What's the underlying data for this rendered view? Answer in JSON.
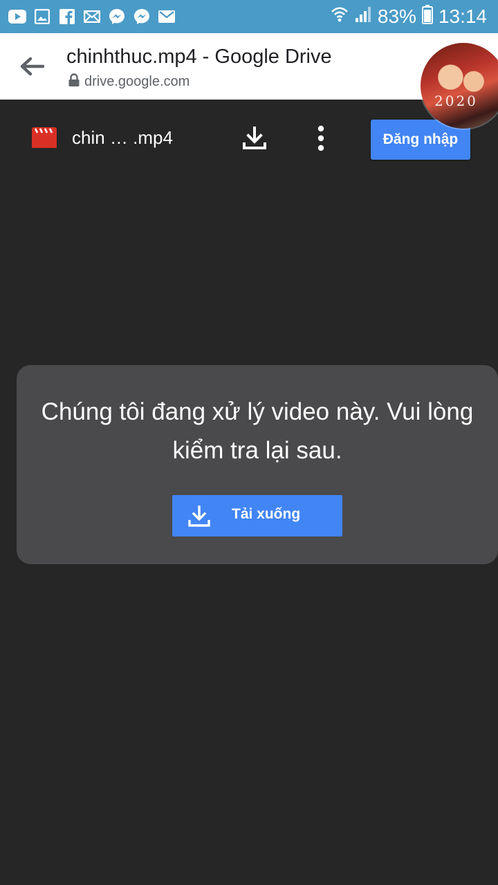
{
  "status_bar": {
    "notification_icons": [
      "youtube-icon",
      "gallery-icon",
      "facebook-icon",
      "email-icon",
      "messenger-icon",
      "messenger-icon",
      "mail-icon"
    ],
    "battery_percent": "83%",
    "time": "13:14"
  },
  "tab": {
    "title": "chinhthuc.mp4 - Google Drive",
    "url": "drive.google.com"
  },
  "avatar": {
    "text": "2020"
  },
  "toolbar": {
    "file_name": "chin … .mp4",
    "signin_label": "Đăng nhập"
  },
  "message_card": {
    "text": "Chúng tôi đang xử lý video này. Vui lòng kiểm tra lại sau.",
    "download_label": "Tải xuống"
  },
  "colors": {
    "status_bar": "#4a9bc7",
    "viewer_background": "#262626",
    "card_background": "#4a494b",
    "accent_blue": "#4285f4",
    "video_icon_red": "#d93025"
  }
}
